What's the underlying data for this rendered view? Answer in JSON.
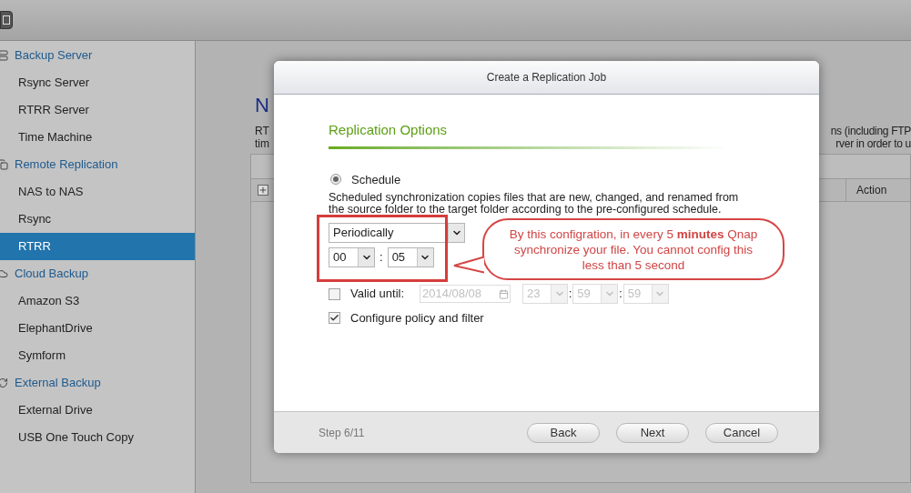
{
  "sidebar": {
    "groups": [
      {
        "label": "Backup Server",
        "items": [
          {
            "label": "Rsync Server",
            "selected": false
          },
          {
            "label": "RTRR Server",
            "selected": false
          },
          {
            "label": "Time Machine",
            "selected": false
          }
        ]
      },
      {
        "label": "Remote Replication",
        "items": [
          {
            "label": "NAS to NAS",
            "selected": false
          },
          {
            "label": "Rsync",
            "selected": false
          },
          {
            "label": "RTRR",
            "selected": true
          }
        ]
      },
      {
        "label": "Cloud Backup",
        "items": [
          {
            "label": "Amazon S3",
            "selected": false
          },
          {
            "label": "ElephantDrive",
            "selected": false
          },
          {
            "label": "Symform",
            "selected": false
          }
        ]
      },
      {
        "label": "External Backup",
        "items": [
          {
            "label": "External Drive",
            "selected": false
          },
          {
            "label": "USB One Touch Copy",
            "selected": false
          }
        ]
      }
    ]
  },
  "background": {
    "heading": "N",
    "description_left": [
      "RT",
      "tim"
    ],
    "description_right": [
      "ns (including FTP",
      "rver in order to u"
    ],
    "table": {
      "columns": [
        "Action"
      ]
    }
  },
  "dialog": {
    "title": "Create a Replication Job",
    "section_title": "Replication Options",
    "schedule": {
      "label": "Schedule",
      "selected": true
    },
    "description": "Scheduled synchronization copies files that are new, changed, and renamed from the source folder to the target folder according to the pre-configured schedule.",
    "frequency": {
      "value": "Periodically"
    },
    "hour": {
      "value": "00"
    },
    "separator": ":",
    "minute": {
      "value": "05"
    },
    "valid_until": {
      "label": "Valid until:",
      "checked": false,
      "date": "2014/08/08",
      "hour": "23",
      "minute": "59",
      "second": "59",
      "disabled": true
    },
    "policy": {
      "label": "Configure policy and filter",
      "checked": true
    },
    "step": "Step 6/11",
    "buttons": [
      "Back",
      "Next",
      "Cancel"
    ]
  },
  "annotation": {
    "text": "By this configration, in every 5 **minutes** Qnap synchronize your file. You cannot config this less than 5 second"
  }
}
